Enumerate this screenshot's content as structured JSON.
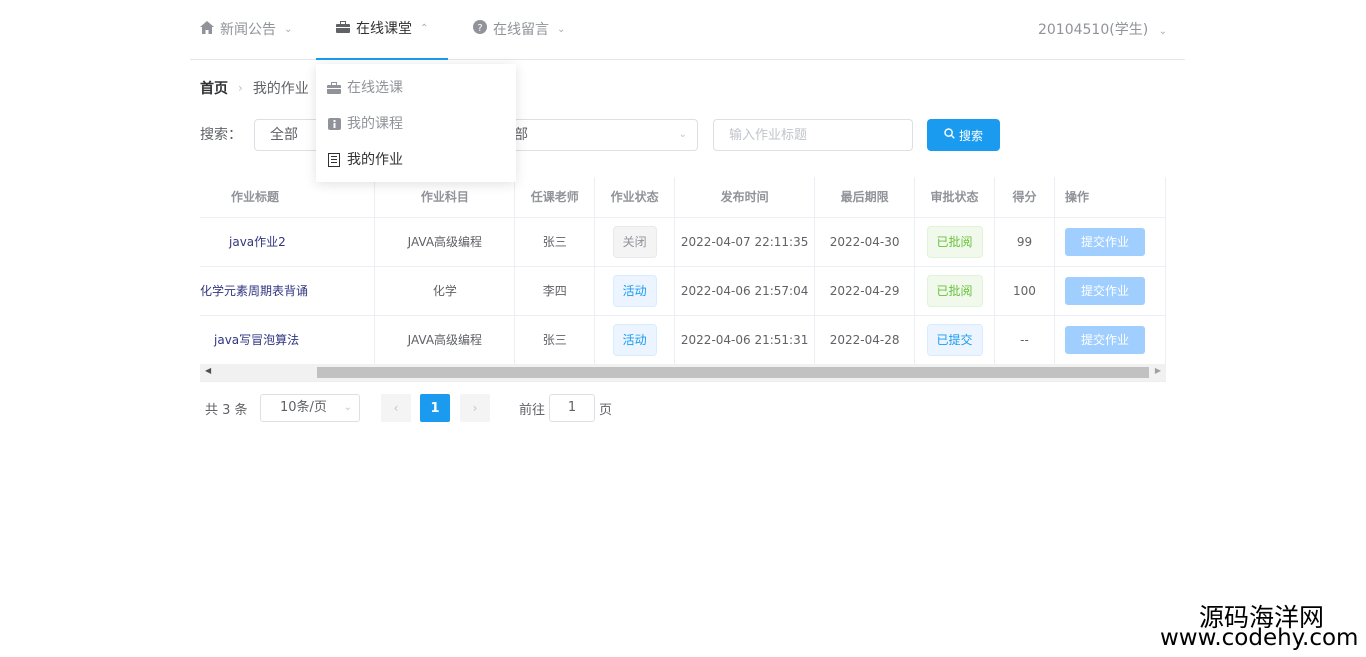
{
  "nav": {
    "items": [
      {
        "label": "新闻公告",
        "icon": "home-icon"
      },
      {
        "label": "在线课堂",
        "icon": "briefcase-icon",
        "active": true
      },
      {
        "label": "在线留言",
        "icon": "question-icon"
      }
    ],
    "user": "20104510(学生)"
  },
  "dropdown": {
    "items": [
      {
        "label": "在线选课",
        "icon": "briefcase-icon"
      },
      {
        "label": "我的课程",
        "icon": "info-icon"
      },
      {
        "label": "我的作业",
        "icon": "document-icon",
        "active": true
      }
    ]
  },
  "breadcrumb": {
    "home": "首页",
    "current": "我的作业"
  },
  "search": {
    "label": "搜索：",
    "select1": "全部",
    "select2": "部",
    "input_placeholder": "输入作业标题",
    "button": "搜索"
  },
  "table": {
    "columns": [
      "作业标题",
      "作业科目",
      "任课老师",
      "作业状态",
      "发布时间",
      "最后期限",
      "审批状态",
      "得分",
      "操作"
    ],
    "rows": [
      {
        "title": "java作业2",
        "subject": "JAVA高级编程",
        "teacher": "张三",
        "status": "关闭",
        "publish": "2022-04-07 22:11:35",
        "deadline": "2022-04-30",
        "approval": "已批阅",
        "score": "99",
        "action": "提交作业"
      },
      {
        "title": "化学元素周期表背诵",
        "subject": "化学",
        "teacher": "李四",
        "status": "活动",
        "publish": "2022-04-06 21:57:04",
        "deadline": "2022-04-29",
        "approval": "已批阅",
        "score": "100",
        "action": "提交作业"
      },
      {
        "title": "java写冒泡算法",
        "subject": "JAVA高级编程",
        "teacher": "张三",
        "status": "活动",
        "publish": "2022-04-06 21:51:31",
        "deadline": "2022-04-28",
        "approval": "已提交",
        "score": "--",
        "action": "提交作业"
      }
    ]
  },
  "pagination": {
    "total": "共 3 条",
    "page_size": "10条/页",
    "current_page": "1",
    "goto_label": "前往",
    "goto_value": "1",
    "page_suffix": "页"
  },
  "watermark": {
    "line1": "源码海洋网",
    "line2": "www.codehy.com"
  },
  "colors": {
    "primary": "#1a9bf0",
    "success": "#67c23a",
    "info": "#909399"
  }
}
